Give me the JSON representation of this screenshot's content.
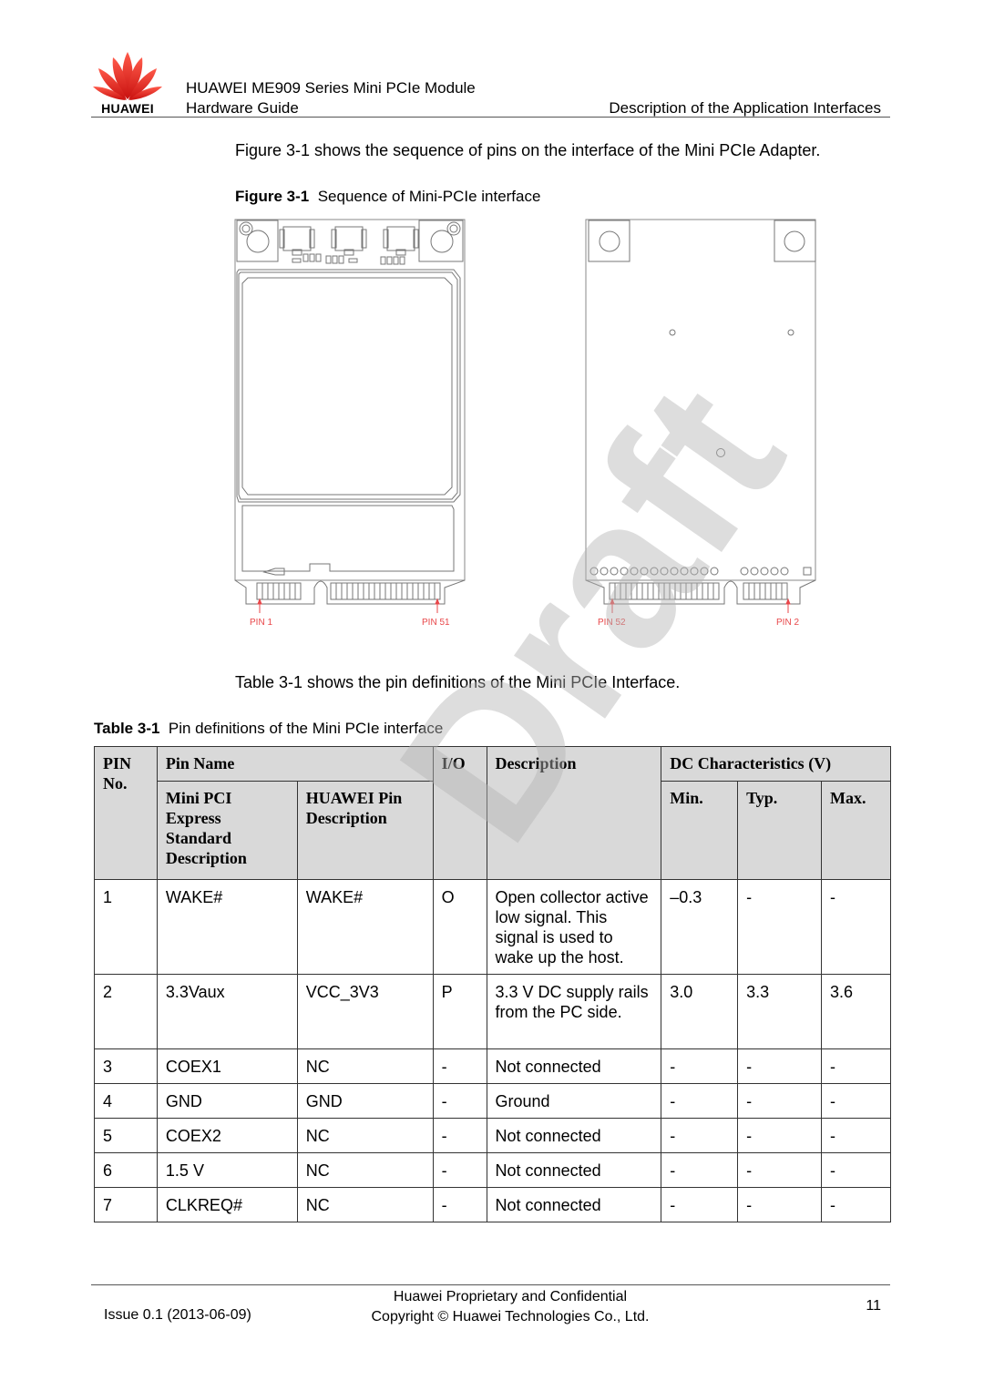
{
  "header": {
    "logo_text": "HUAWEI",
    "title_line1": "HUAWEI ME909 Series Mini PCIe Module",
    "title_line2": "Hardware Guide",
    "section": "Description of the Application Interfaces"
  },
  "intro_paragraph": "Figure 3-1 shows the sequence of pins on the interface of the Mini PCIe Adapter.",
  "figure": {
    "label": "Figure 3-1",
    "caption": "Sequence of Mini-PCIe interface",
    "pin_labels": {
      "front_left": "PIN 1",
      "front_right": "PIN 51",
      "back_left": "PIN 52",
      "back_right": "PIN 2"
    }
  },
  "table_paragraph": "Table 3-1 shows the pin definitions of the Mini PCIe Interface.",
  "table": {
    "label": "Table 3-1",
    "caption": "Pin definitions of the Mini PCIe interface",
    "headers": {
      "pin_no": "PIN No.",
      "pin_name": "Pin Name",
      "mini_pci": "Mini PCI Express Standard Description",
      "huawei_pin": "HUAWEI Pin Description",
      "io": "I/O",
      "description": "Description",
      "dc": "DC Characteristics (V)",
      "min": "Min.",
      "typ": "Typ.",
      "max": "Max."
    },
    "rows": [
      {
        "pin": "1",
        "std": "WAKE#",
        "huawei": "WAKE#",
        "io": "O",
        "desc": "Open collector active low signal. This signal is used to wake up the host.",
        "min": "–0.3",
        "typ": "-",
        "max": "-"
      },
      {
        "pin": "2",
        "std": "3.3Vaux",
        "huawei": "VCC_3V3",
        "io": "P",
        "desc": "3.3 V DC supply rails from the PC side.",
        "min": "3.0",
        "typ": "3.3",
        "max": "3.6"
      },
      {
        "pin": "3",
        "std": "COEX1",
        "huawei": "NC",
        "io": "-",
        "desc": "Not connected",
        "min": "-",
        "typ": "-",
        "max": "-"
      },
      {
        "pin": "4",
        "std": "GND",
        "huawei": "GND",
        "io": "-",
        "desc": "Ground",
        "min": "-",
        "typ": "-",
        "max": "-"
      },
      {
        "pin": "5",
        "std": "COEX2",
        "huawei": "NC",
        "io": "-",
        "desc": "Not connected",
        "min": "-",
        "typ": "-",
        "max": "-"
      },
      {
        "pin": "6",
        "std": "1.5 V",
        "huawei": "NC",
        "io": "-",
        "desc": "Not connected",
        "min": "-",
        "typ": "-",
        "max": "-"
      },
      {
        "pin": "7",
        "std": "CLKREQ#",
        "huawei": "NC",
        "io": "-",
        "desc": "Not connected",
        "min": "-",
        "typ": "-",
        "max": "-"
      }
    ]
  },
  "watermark": "Draft",
  "footer": {
    "issue": "Issue 0.1 (2013-06-09)",
    "line1": "Huawei Proprietary and Confidential",
    "line2": "Copyright © Huawei Technologies Co., Ltd.",
    "page": "11"
  },
  "colors": {
    "brand_red": "#e3231b",
    "pin_label": "#e8474a",
    "header_fill": "#d9d9d9"
  }
}
